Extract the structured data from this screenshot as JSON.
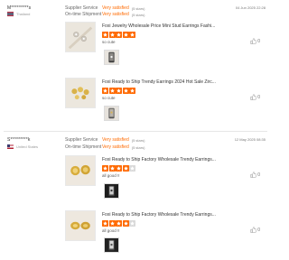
{
  "reviews": [
    {
      "reviewer": "M*********s",
      "country": "Thailand",
      "supplier_service": {
        "label": "Supplier Service",
        "value": "Very satisfied",
        "stars": "(5 stars)"
      },
      "on_time_shipment": {
        "label": "On-time Shipment",
        "value": "Very satisfied",
        "stars": "(5 stars)"
      },
      "date": "04 Jun 2025 22:28",
      "items": [
        {
          "title": "Foxi Jewelry Wholesale Price Mini Stud Earrings Fashi...",
          "rating": 5,
          "comment": "so cute",
          "likes": "0"
        },
        {
          "title": "Foxi Ready to Ship Trendy Earrings 2024 Hot Sale Zirc...",
          "rating": 5,
          "comment": "so cute",
          "likes": "0"
        }
      ]
    },
    {
      "reviewer": "S*********k",
      "country": "United States",
      "supplier_service": {
        "label": "Supplier Service",
        "value": "Very satisfied",
        "stars": "(5 stars)"
      },
      "on_time_shipment": {
        "label": "On-time Shipment",
        "value": "Very satisfied",
        "stars": "(5 stars)"
      },
      "date": "12 May 2025 08:35",
      "items": [
        {
          "title": "Foxi Ready to Ship Factory Wholesale Trendy Earrings...",
          "rating": 4,
          "comment": "all good !!",
          "likes": "0"
        },
        {
          "title": "Foxi Ready to Ship Factory Wholesale Trendy Earrings...",
          "rating": 4,
          "comment": "all good !!",
          "likes": "0"
        }
      ]
    }
  ],
  "colors": {
    "accent": "#ff6a00",
    "star_filled": "#ff6a00",
    "star_empty": "#d9d9d9"
  }
}
